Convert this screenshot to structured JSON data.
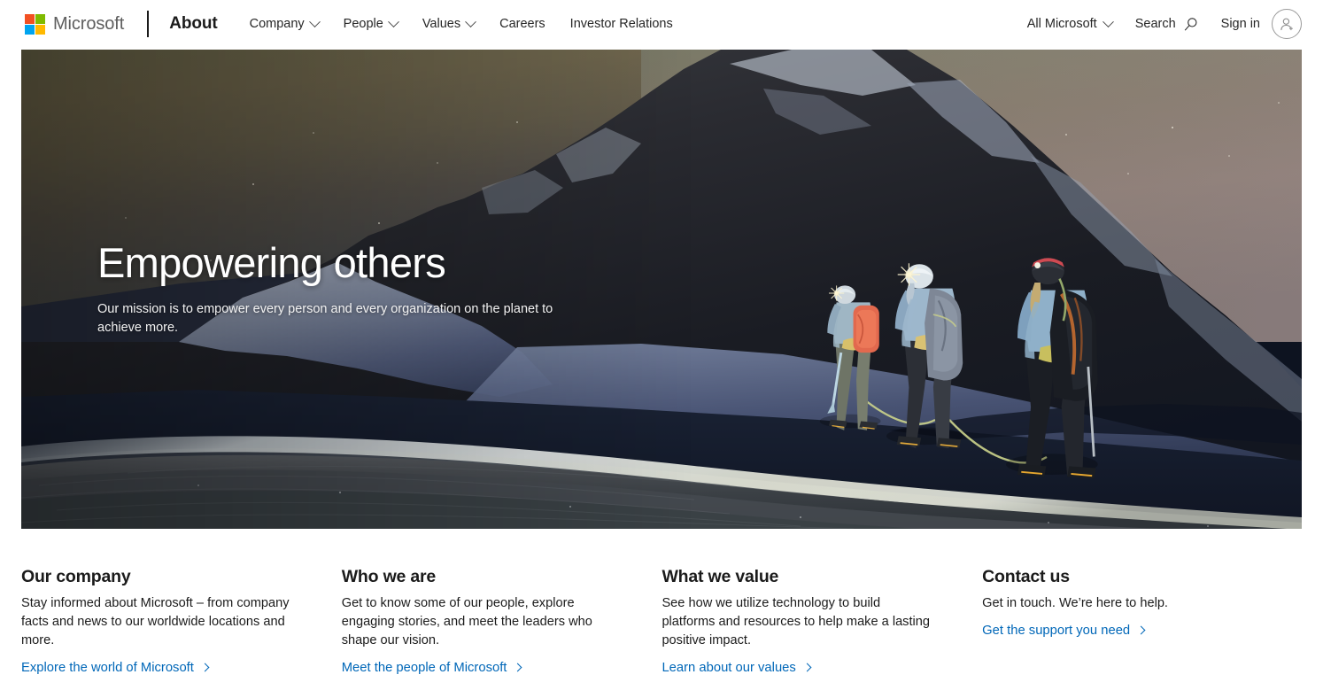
{
  "header": {
    "brand": "Microsoft",
    "section_label": "About",
    "nav_items": [
      {
        "label": "Company",
        "has_chevron": true
      },
      {
        "label": "People",
        "has_chevron": true
      },
      {
        "label": "Values",
        "has_chevron": true
      },
      {
        "label": "Careers",
        "has_chevron": false
      },
      {
        "label": "Investor Relations",
        "has_chevron": false
      }
    ],
    "right_items": {
      "all_microsoft": "All Microsoft",
      "search": "Search",
      "sign_in": "Sign in"
    },
    "icons": {
      "logo": "microsoft-squares-icon",
      "chevron": "chevron-down-icon",
      "search": "search-icon",
      "account": "account-person-icon"
    },
    "logo_colors": {
      "red": "#f25022",
      "green": "#7fba00",
      "blue": "#00a4ef",
      "yellow": "#ffb900"
    }
  },
  "hero": {
    "title": "Empowering others",
    "subtitle": "Our mission is to empower every person and every organization on the planet to achieve more.",
    "scene": "night-mountain-climbers-photo",
    "scene_description": "Three roped climbers with headlamps traversing a snowfield below a dark rocky peak at twilight"
  },
  "cards": [
    {
      "title": "Our company",
      "description": "Stay informed about Microsoft – from company facts and news to our worldwide locations and more.",
      "link_label": "Explore the world of Microsoft",
      "link_icon": "chevron-right-icon"
    },
    {
      "title": "Who we are",
      "description": "Get to know some of our people, explore engaging stories, and meet the leaders who shape our vision.",
      "link_label": "Meet the people of Microsoft",
      "link_icon": "chevron-right-icon"
    },
    {
      "title": "What we value",
      "description": "See how we utilize technology to build platforms and resources to help make a lasting positive impact.",
      "link_label": "Learn about our values",
      "link_icon": "chevron-right-icon"
    },
    {
      "title": "Contact us",
      "description": "Get in touch. We’re here to help.",
      "link_label": "Get the support you need",
      "link_icon": "chevron-right-icon"
    }
  ],
  "colors": {
    "link_blue": "#0067b8",
    "text_dark": "#1b1b1b",
    "wordmark_gray": "#5e5e5e"
  }
}
